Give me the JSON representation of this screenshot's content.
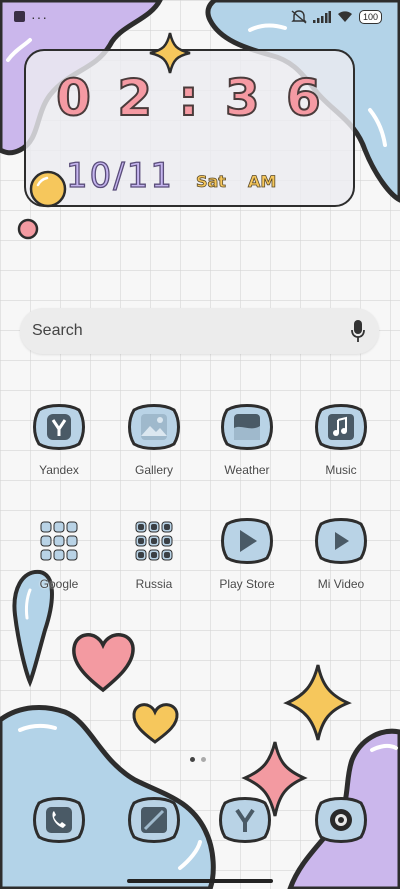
{
  "status_bar": {
    "battery": "100",
    "icons": [
      "app-notification-icon",
      "more-dots-icon",
      "mute-icon",
      "signal-icon",
      "wifi-icon",
      "battery-icon"
    ]
  },
  "clock_widget": {
    "time_h1": "0",
    "time_h2": "2",
    "time_sep": ":",
    "time_m1": "3",
    "time_m2": "6",
    "date": "10/11",
    "day": "Sat",
    "ampm": "AM"
  },
  "search": {
    "label": "Search",
    "icon": "mic-icon"
  },
  "apps": [
    {
      "label": "Yandex",
      "icon": "yandex-icon"
    },
    {
      "label": "Gallery",
      "icon": "gallery-icon"
    },
    {
      "label": "Weather",
      "icon": "weather-icon"
    },
    {
      "label": "Music",
      "icon": "music-icon"
    },
    {
      "label": "Google",
      "icon": "google-folder-icon"
    },
    {
      "label": "Russia",
      "icon": "russia-folder-icon"
    },
    {
      "label": "Play Store",
      "icon": "play-store-icon"
    },
    {
      "label": "Mi Video",
      "icon": "mi-video-icon"
    }
  ],
  "dock": [
    {
      "icon": "phone-icon"
    },
    {
      "icon": "notes-icon"
    },
    {
      "icon": "yandex-browser-icon"
    },
    {
      "icon": "camera-icon"
    }
  ],
  "pager": {
    "pages": 2,
    "current": 1
  },
  "colors": {
    "blob_blue": "#b3d3e8",
    "blob_purple": "#cbb7ec",
    "heart_pink": "#f39aa1",
    "star_yellow": "#f6c75c",
    "icon_fill": "#b9d3e6",
    "outline": "#2d2d2d"
  }
}
